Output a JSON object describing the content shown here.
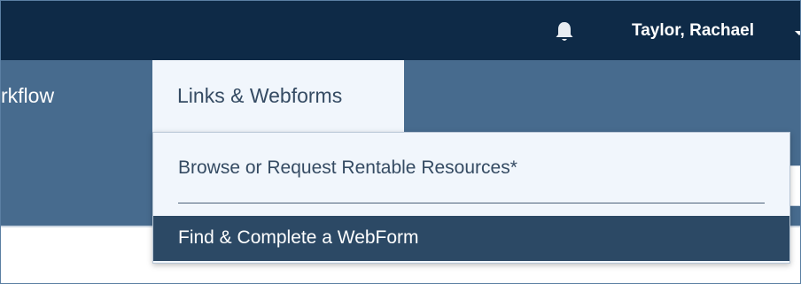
{
  "header": {
    "notification_icon": "bell-icon",
    "user_name": "Taylor, Rachael",
    "user_menu_icon": "caret-down-icon",
    "colors": {
      "topbar": "#0e2a47",
      "navbar": "#476b8e",
      "dropdown_bg": "#f1f6fc",
      "active_item": "#2c4965"
    }
  },
  "nav": {
    "workflow_label": "rkflow",
    "links_tab_label": "Links & Webforms"
  },
  "dropdown": {
    "items": [
      {
        "label": "Browse or Request Rentable Resources*"
      },
      {
        "label": "Find & Complete a WebForm"
      }
    ]
  }
}
